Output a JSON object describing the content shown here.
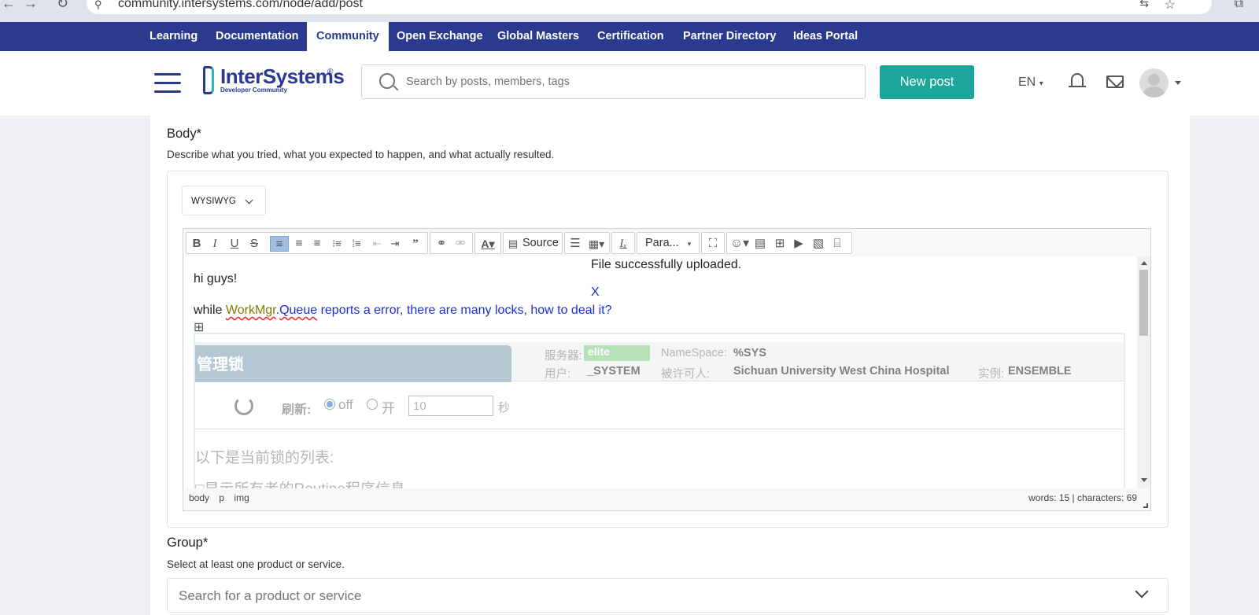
{
  "browser": {
    "url": "community.intersystems.com/node/add/post"
  },
  "topnav": {
    "items": [
      "Learning",
      "Documentation",
      "Community",
      "Open Exchange",
      "Global Masters",
      "Certification",
      "Partner Directory",
      "Ideas Portal"
    ],
    "active": "Community"
  },
  "header": {
    "logo_name": "InterSystems",
    "logo_tm": "®",
    "logo_sub": "Developer Community",
    "search_placeholder": "Search by posts, members, tags",
    "new_post_label": "New post",
    "language": "EN"
  },
  "form": {
    "body_label": "Body*",
    "body_hint": "Describe what you tried, what you expected to happen, and what actually resulted.",
    "format_selected": "WYSIWYG",
    "toolbar": {
      "source_label": "Source",
      "paragraph_label": "Para..."
    },
    "content": {
      "line1": "hi guys!",
      "line2_prefix": "while ",
      "line2_word1": "WorkMgr",
      "line2_dot": ".",
      "line2_word2": "Queue",
      "line2_rest": " reports a error,  there are many locks, how to deal it?",
      "notice": "File successfully uploaded.",
      "notice_close": "X"
    },
    "screenshot": {
      "title": "管理锁",
      "server_label": "服务器:",
      "server_value": "elite",
      "namespace_label": "NameSpace:",
      "namespace_value": "%SYS",
      "user_label": "用户:",
      "user_value": "_SYSTEM",
      "licensee_label": "被许可人:",
      "licensee_value": "Sichuan University West China Hospital",
      "instance_label": "实例:",
      "instance_value": "ENSEMBLE",
      "refresh_label": "刷新:",
      "off_label": "off",
      "on_label": "开",
      "interval_value": "10",
      "seconds_label": "秒",
      "list_heading": "以下是当前锁的列表:",
      "cut_line": "□显示所有者的Routine程序信息"
    },
    "statusbar": {
      "path": [
        "body",
        "p",
        "img"
      ],
      "counts": "words: 15 | characters: 69"
    },
    "group_label": "Group*",
    "group_hint": "Select at least one product or service.",
    "group_placeholder": "Search for a product or service"
  },
  "colors": {
    "nav_bg": "#2b3a8f",
    "accent": "#1aa69b",
    "link_blue": "#1a2fd9"
  }
}
